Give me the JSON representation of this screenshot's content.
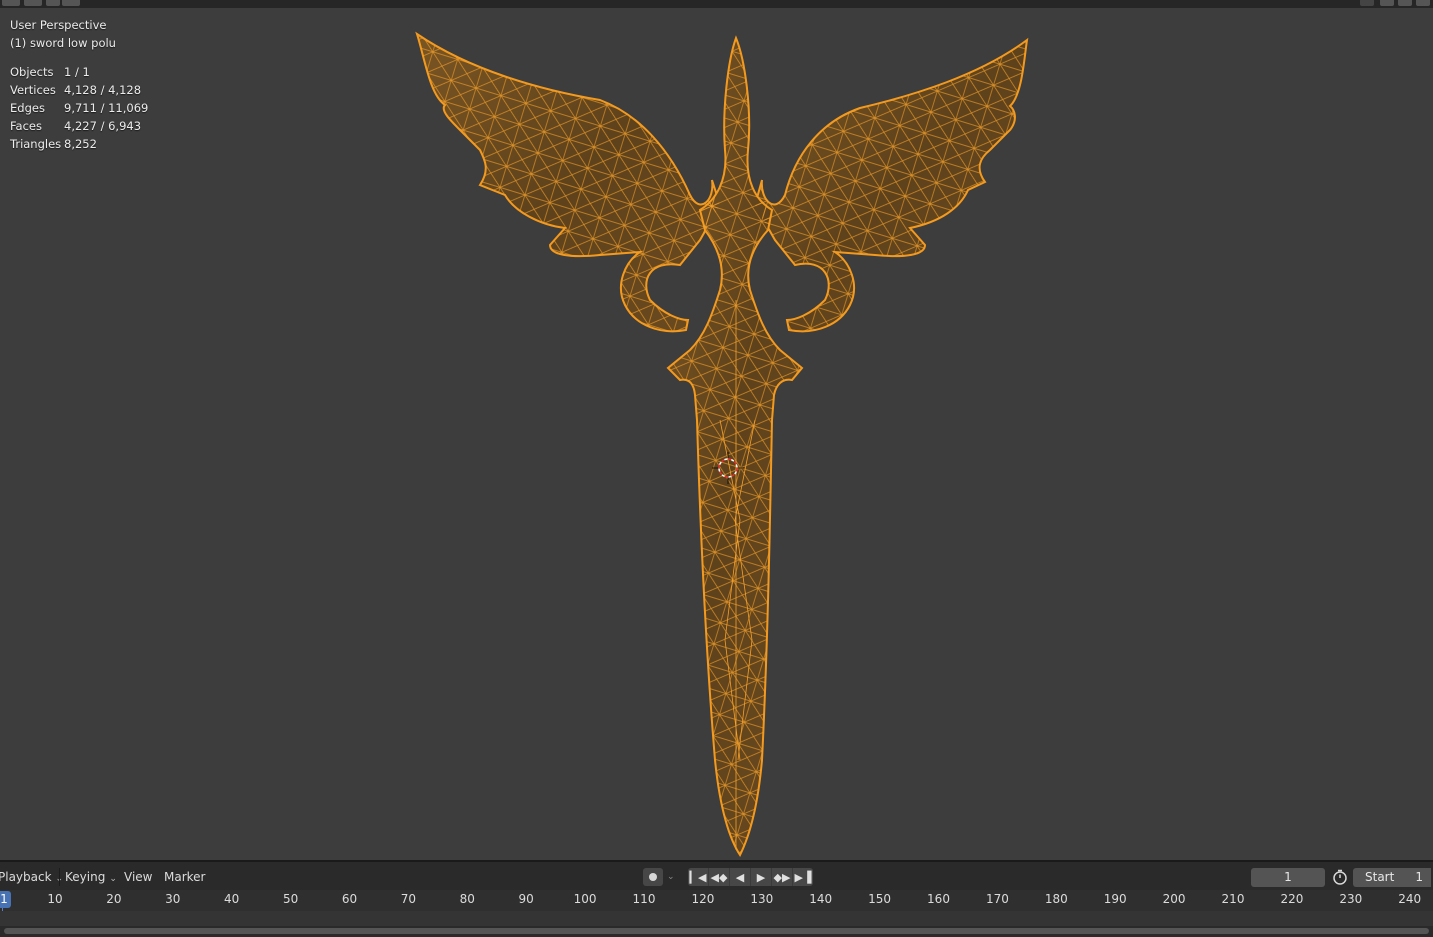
{
  "viewport": {
    "perspective": "User Perspective",
    "object_name": "(1) sword low polu",
    "stats": [
      {
        "label": "Objects",
        "value": "1 / 1"
      },
      {
        "label": "Vertices",
        "value": "4,128 / 4,128"
      },
      {
        "label": "Edges",
        "value": "9,711 / 11,069"
      },
      {
        "label": "Faces",
        "value": "4,227 / 6,943"
      },
      {
        "label": "Triangles",
        "value": "8,252"
      }
    ],
    "selection_color": "#f39a1e"
  },
  "timeline": {
    "menus": {
      "playback": "Playback",
      "keying": "Keying",
      "view": "View",
      "marker": "Marker"
    },
    "current_frame": "1",
    "start_label": "Start",
    "start_value": "1",
    "ruler_labels": [
      "10",
      "20",
      "30",
      "40",
      "50",
      "60",
      "70",
      "80",
      "90",
      "100",
      "110",
      "120",
      "130",
      "140",
      "150",
      "160",
      "170",
      "180",
      "190",
      "200",
      "210",
      "220",
      "230",
      "240"
    ],
    "playhead_frame": "1",
    "accent_color": "#4772b3"
  }
}
